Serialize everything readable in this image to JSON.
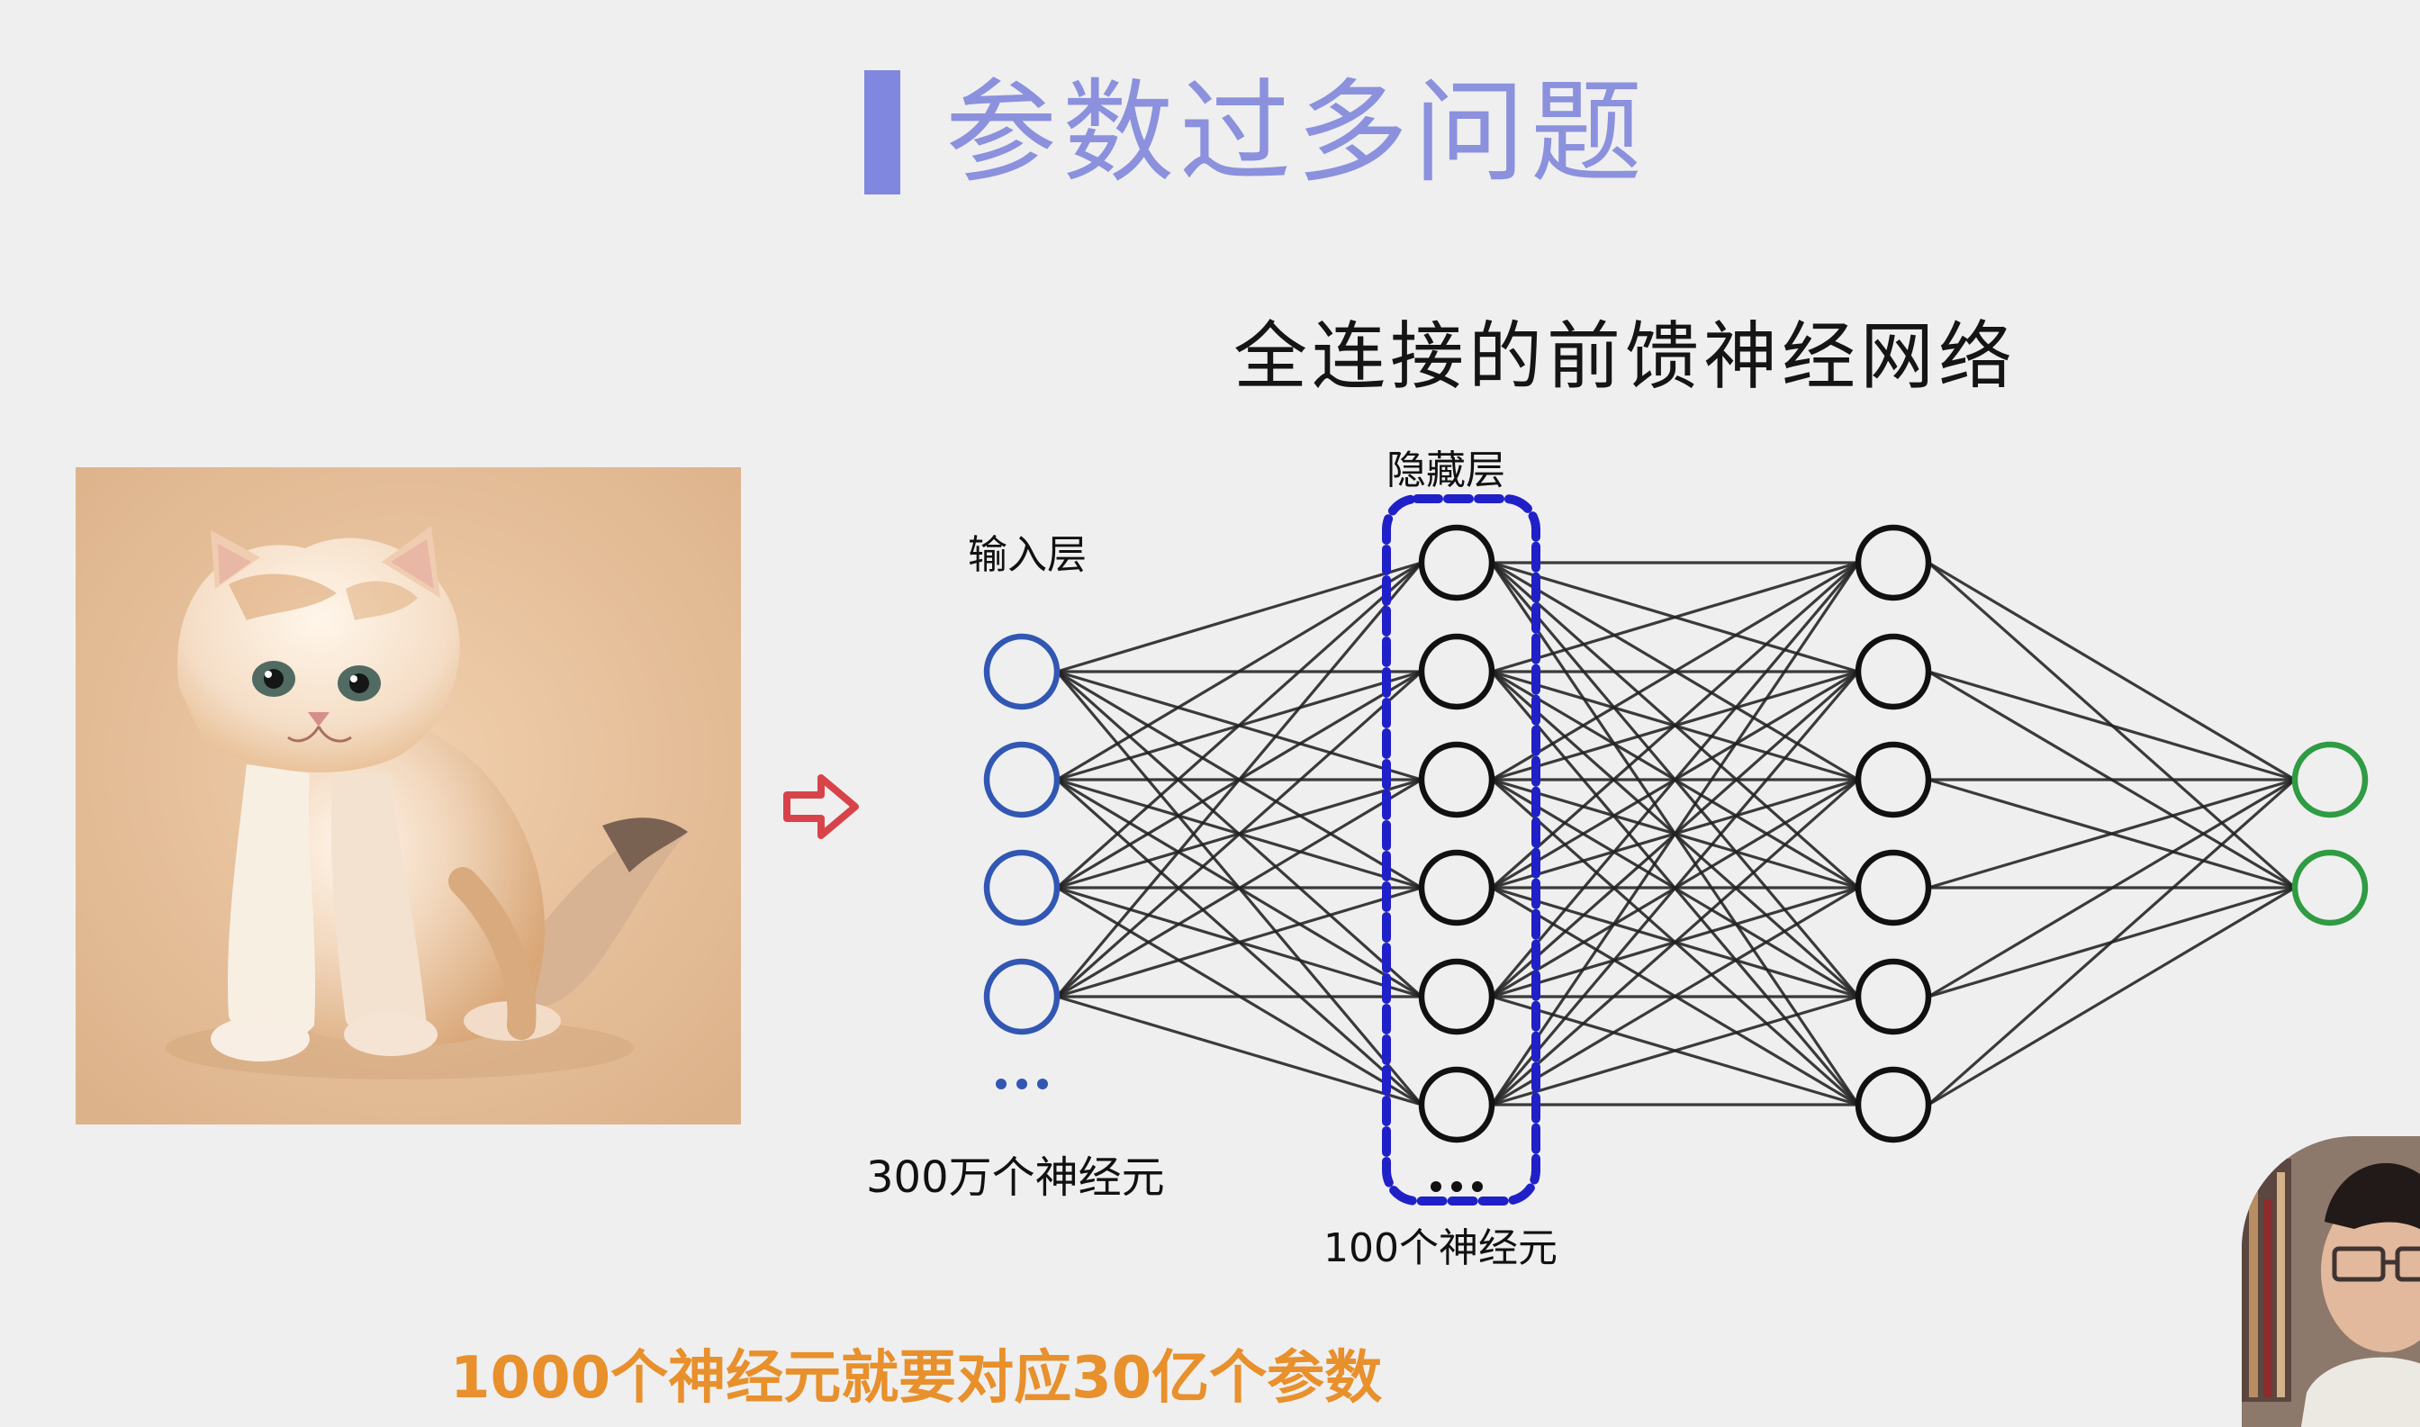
{
  "title": "参数过多问题",
  "subtitle": "全连接的前馈神经网络",
  "input_layer_label": "输入层",
  "hidden_layer_label": "隐藏层",
  "input_count_label": "300万个神经元",
  "hidden_count_label": "100个神经元",
  "conclusion": "1000个神经元就要对应30亿个参数",
  "colors": {
    "title": "#8b91dd",
    "title_bar": "#7f87de",
    "input_nodes": "#3157b3",
    "hidden_nodes": "#111111",
    "output_nodes": "#2f9b43",
    "hidden_box": "#2020c8",
    "arrow": "#d8434a",
    "conclusion": "#e8902c"
  },
  "network": {
    "input_nodes": 4,
    "hidden_layer_1_nodes": 6,
    "hidden_layer_2_nodes": 6,
    "output_nodes": 2,
    "continuation": "..."
  },
  "icons": {
    "arrow": "hollow-right-arrow-icon",
    "photo": "kitten-photo",
    "presenter": "presenter-webcam"
  }
}
